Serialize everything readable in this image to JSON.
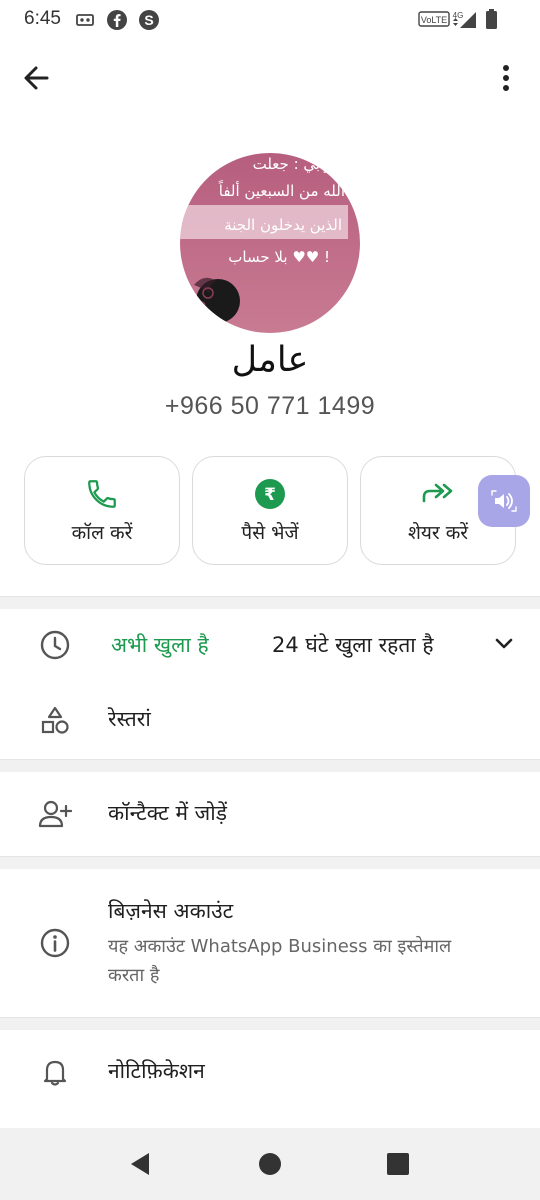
{
  "status_bar": {
    "time": "6:45",
    "network": "VoLTE",
    "signal_type": "4G"
  },
  "contact": {
    "name": "عامل",
    "phone": "+966 50 771 1499",
    "avatar_text": [
      "ي وابي : جعلت",
      "الله من السبعين ألفاً",
      "الذين يدخلون الجنة",
      "بلا حساب ♥♥ !"
    ]
  },
  "actions": [
    {
      "label": "कॉल करें",
      "icon": "phone-icon"
    },
    {
      "label": "पैसे भेजें",
      "icon": "rupee-icon",
      "symbol": "₹"
    },
    {
      "label": "शेयर करें",
      "icon": "share-arrow-icon"
    }
  ],
  "info": {
    "open_status": "अभी खुला है",
    "hours": "24 घंटे खुला रहता है",
    "category": "रेस्तरां",
    "add_contact": "कॉन्टैक्ट में जोड़ें",
    "business_title": "बिज़नेस अकाउंट",
    "business_desc": "यह अकाउंट WhatsApp Business का इस्तेमाल करता है",
    "notifications": "नोटिफ़िकेशन"
  },
  "colors": {
    "accent_green": "#1d9a4f",
    "floating_button": "#a9a6e8"
  }
}
